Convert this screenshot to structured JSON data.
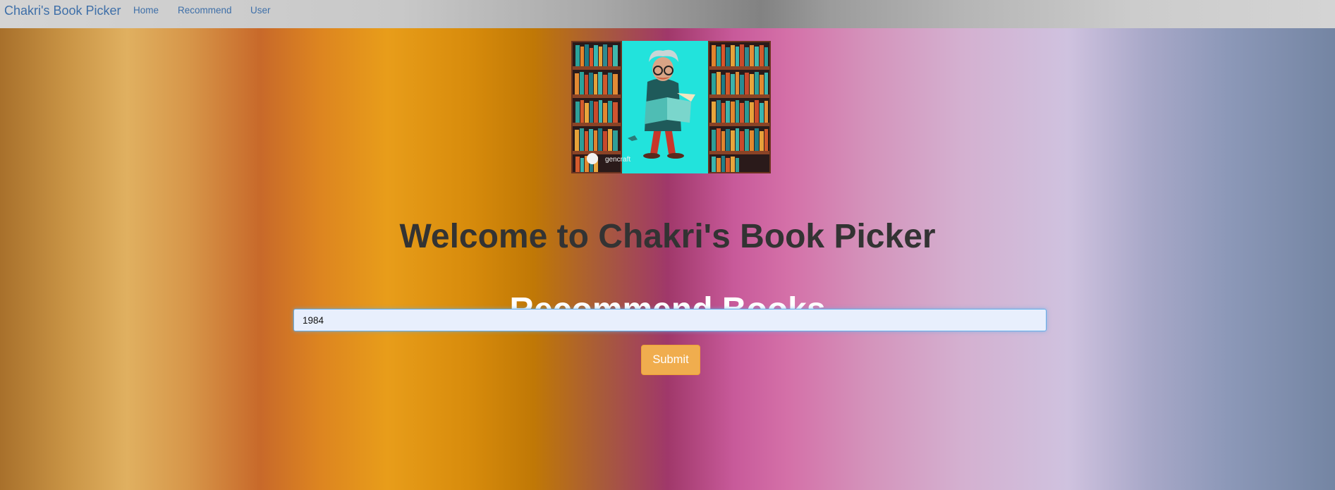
{
  "navbar": {
    "brand": "Chakri's Book Picker",
    "links": [
      {
        "label": "Home"
      },
      {
        "label": "Recommend"
      },
      {
        "label": "User"
      }
    ]
  },
  "hero": {
    "watermark": "gencraft"
  },
  "main": {
    "welcome_heading": "Welcome to Chakri's Book Picker",
    "section_title": "Recommend Books",
    "search_value": "1984",
    "submit_label": "Submit"
  },
  "colors": {
    "link": "#3e6fa8",
    "submit_button": "#f0ad4e",
    "heading": "#333333",
    "section_title": "#ffffff"
  }
}
